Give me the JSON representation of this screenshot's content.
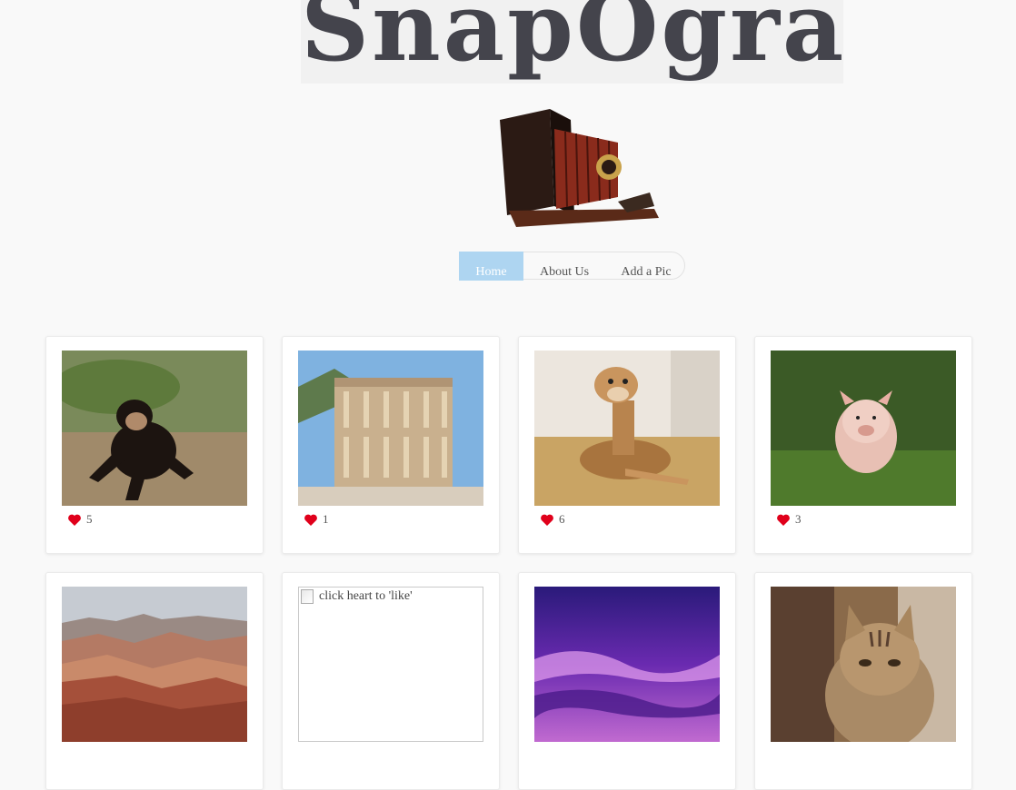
{
  "site": {
    "logo_text": "SnapOgram"
  },
  "nav": {
    "items": [
      {
        "label": "Home",
        "active": true
      },
      {
        "label": "About Us",
        "active": false
      },
      {
        "label": "Add a Pic",
        "active": false
      }
    ]
  },
  "posts": [
    {
      "subject": "chimpanzee",
      "likes": "5"
    },
    {
      "subject": "library-ruins",
      "likes": "1"
    },
    {
      "subject": "baby-giraffe",
      "likes": "6"
    },
    {
      "subject": "piglet",
      "likes": "3"
    },
    {
      "subject": "painted-desert",
      "likes": ""
    },
    {
      "subject": "broken-image",
      "alt": "click heart to 'like'",
      "likes": ""
    },
    {
      "subject": "purple-sky",
      "likes": ""
    },
    {
      "subject": "tabby-cat",
      "likes": ""
    }
  ],
  "colors": {
    "heart": "#e0001b",
    "nav_active": "#aed5f1"
  }
}
